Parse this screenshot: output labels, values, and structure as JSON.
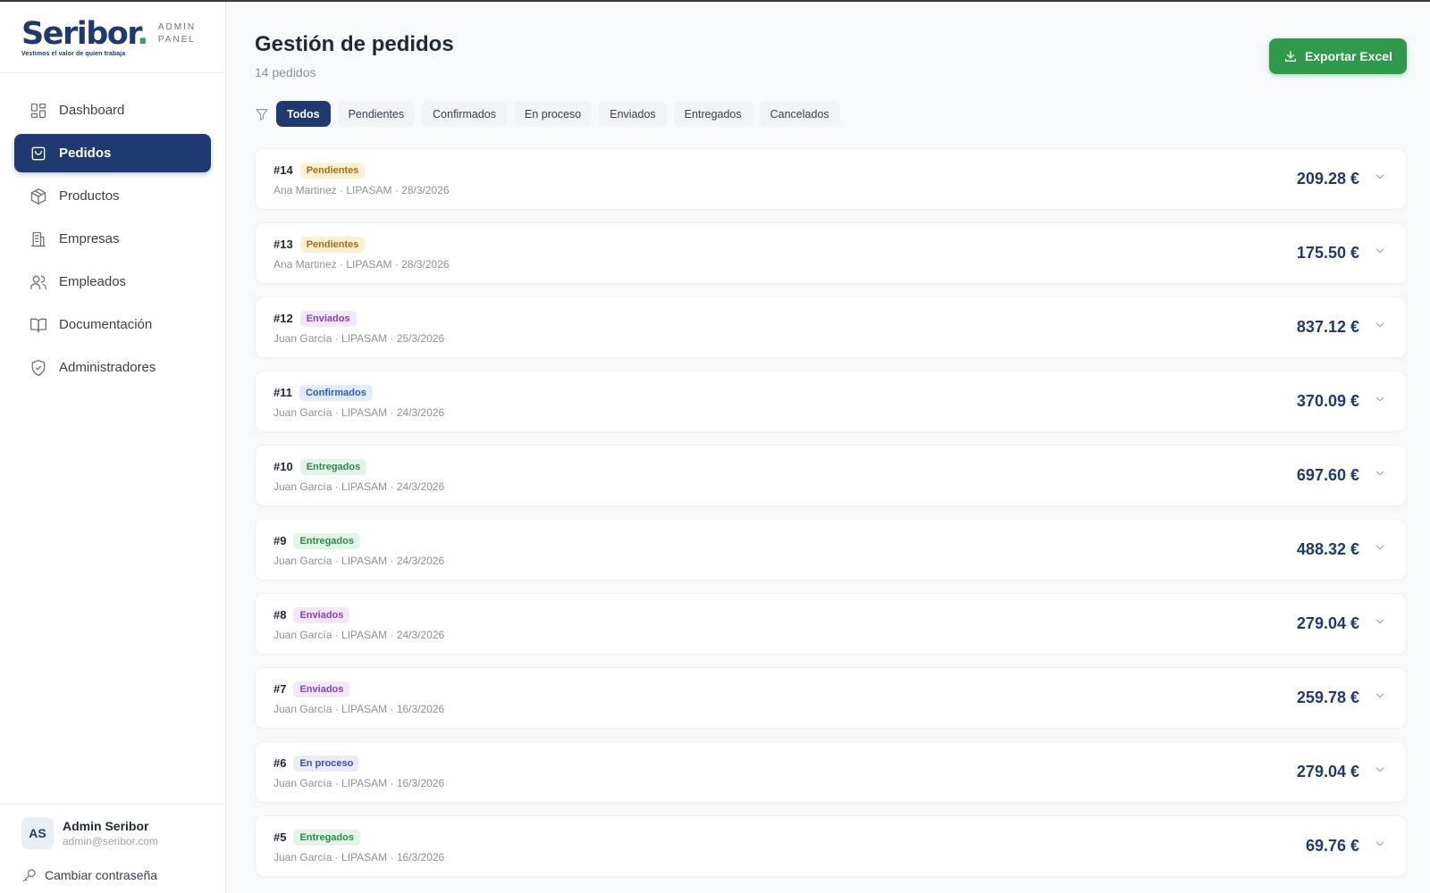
{
  "brand": {
    "name": "Seribor",
    "dot": ".",
    "tagline": "Vestimos el valor de quien trabaja",
    "sub_line1": "ADMIN",
    "sub_line2": "PANEL"
  },
  "sidebar": {
    "items": [
      {
        "label": "Dashboard",
        "icon": "dashboard-icon",
        "active": false
      },
      {
        "label": "Pedidos",
        "icon": "shopping-bag-icon",
        "active": true
      },
      {
        "label": "Productos",
        "icon": "box-icon",
        "active": false
      },
      {
        "label": "Empresas",
        "icon": "building-icon",
        "active": false
      },
      {
        "label": "Empleados",
        "icon": "users-icon",
        "active": false
      },
      {
        "label": "Documentación",
        "icon": "book-icon",
        "active": false
      },
      {
        "label": "Administradores",
        "icon": "shield-icon",
        "active": false
      }
    ]
  },
  "user": {
    "initials": "AS",
    "name": "Admin Seribor",
    "email": "admin@seribor.com",
    "change_password": "Cambiar contraseña"
  },
  "header": {
    "title": "Gestión de pedidos",
    "subtitle": "14 pedidos",
    "export_label": "Exportar Excel"
  },
  "filters": [
    {
      "label": "Todos",
      "active": true
    },
    {
      "label": "Pendientes",
      "active": false
    },
    {
      "label": "Confirmados",
      "active": false
    },
    {
      "label": "En proceso",
      "active": false
    },
    {
      "label": "Enviados",
      "active": false
    },
    {
      "label": "Entregados",
      "active": false
    },
    {
      "label": "Cancelados",
      "active": false
    }
  ],
  "orders": [
    {
      "id": "#14",
      "status": "Pendientes",
      "meta": "Ana Martinez · LIPASAM · 28/3/2026",
      "total": "209.28 €"
    },
    {
      "id": "#13",
      "status": "Pendientes",
      "meta": "Ana Martinez · LIPASAM · 28/3/2026",
      "total": "175.50 €"
    },
    {
      "id": "#12",
      "status": "Enviados",
      "meta": "Juan García · LIPASAM · 25/3/2026",
      "total": "837.12 €"
    },
    {
      "id": "#11",
      "status": "Confirmados",
      "meta": "Juan García · LIPASAM · 24/3/2026",
      "total": "370.09 €"
    },
    {
      "id": "#10",
      "status": "Entregados",
      "meta": "Juan García · LIPASAM · 24/3/2026",
      "total": "697.60 €"
    },
    {
      "id": "#9",
      "status": "Entregados",
      "meta": "Juan García · LIPASAM · 24/3/2026",
      "total": "488.32 €"
    },
    {
      "id": "#8",
      "status": "Enviados",
      "meta": "Juan García · LIPASAM · 24/3/2026",
      "total": "279.04 €"
    },
    {
      "id": "#7",
      "status": "Enviados",
      "meta": "Juan García · LIPASAM · 16/3/2026",
      "total": "259.78 €"
    },
    {
      "id": "#6",
      "status": "En proceso",
      "meta": "Juan García · LIPASAM · 16/3/2026",
      "total": "279.04 €"
    },
    {
      "id": "#5",
      "status": "Entregados",
      "meta": "Juan García · LIPASAM · 16/3/2026",
      "total": "69.76 €"
    }
  ],
  "colors": {
    "primary": "#1e3a70",
    "accent_green": "#2f9a4c"
  }
}
